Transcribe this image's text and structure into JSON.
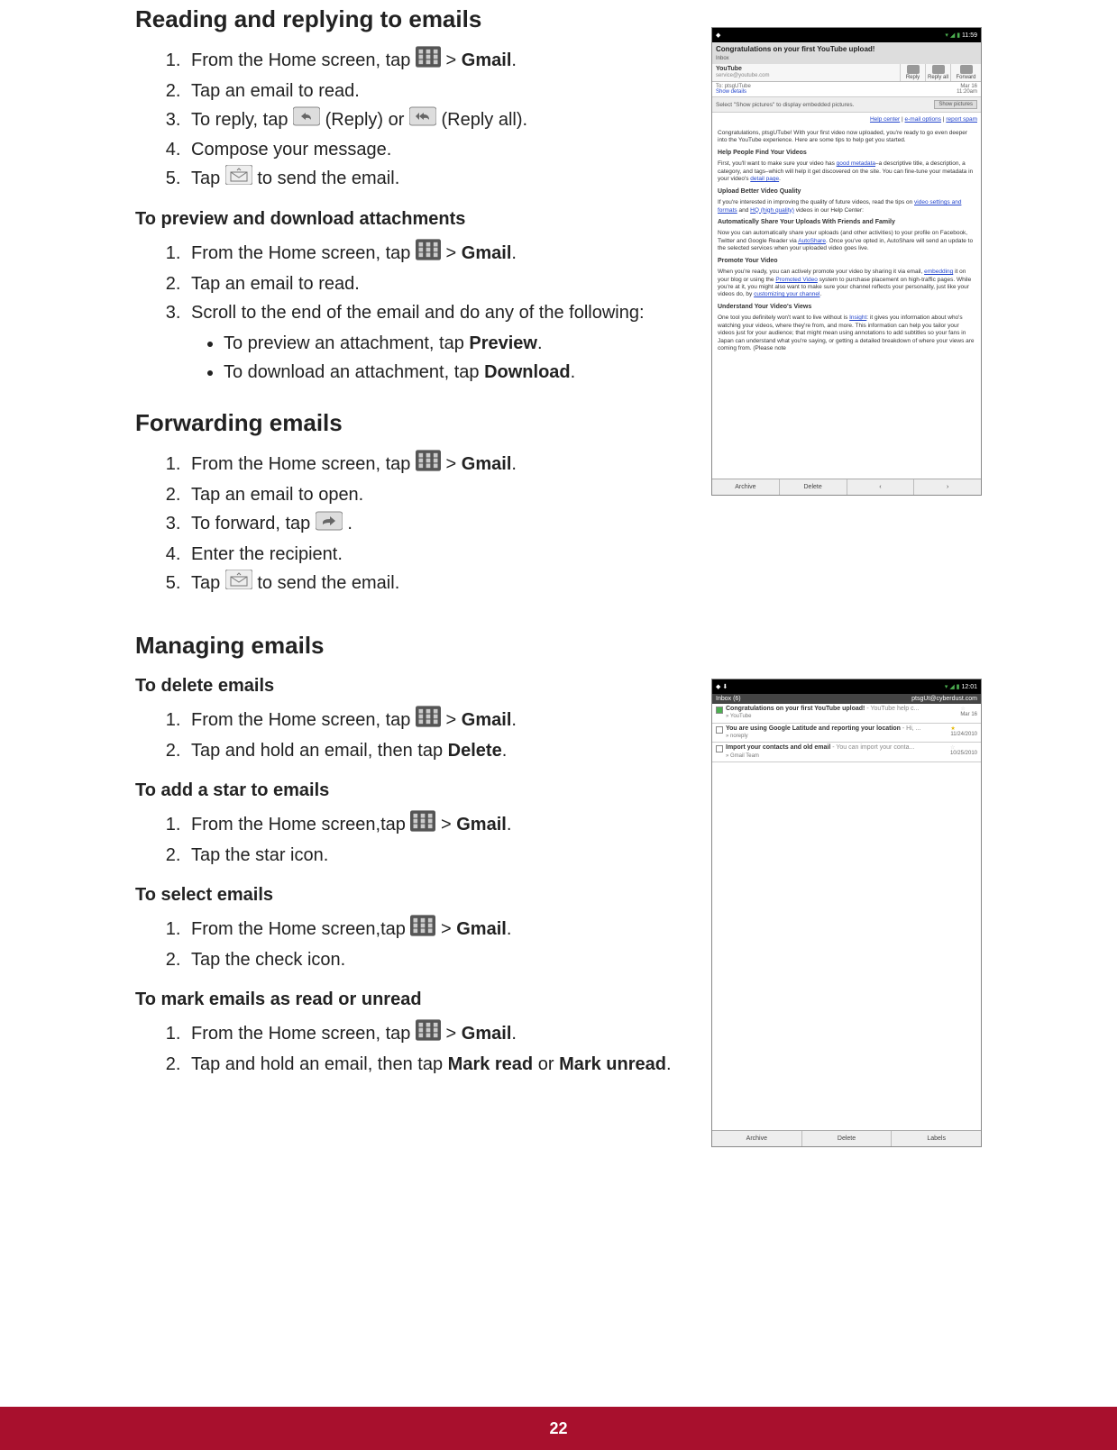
{
  "page_number": "22",
  "s1": {
    "title": "Reading and replying to emails",
    "step1_a": "From the Home screen, tap ",
    "step1_sep": " > ",
    "gmail": "Gmail",
    "step1_end": ".",
    "step2": "Tap an email to read.",
    "step3_a": "To reply, tap ",
    "step3_b": " (Reply) or ",
    "step3_c": " (Reply all).",
    "step4": "Compose your message.",
    "step5_a": "Tap ",
    "step5_b": " to send the email."
  },
  "s2": {
    "title": "To preview and download attachments",
    "step1_a": "From the Home screen, tap ",
    "step2": "Tap an email to read.",
    "step3": "Scroll to the end of the email and do any of the following:",
    "b1_a": "To preview an attachment, tap ",
    "b1_b": "Preview",
    "b1_c": ".",
    "b2_a": "To download an attachment, tap ",
    "b2_b": "Download",
    "b2_c": "."
  },
  "s3": {
    "title": "Forwarding emails",
    "step1_a": "From the Home screen, tap ",
    "step2": "Tap an email to open.",
    "step3_a": "To forward, tap ",
    "step3_b": " .",
    "step4": "Enter the recipient.",
    "step5_a": "Tap ",
    "step5_b": " to send the email."
  },
  "s4": {
    "title": "Managing emails"
  },
  "s5": {
    "title": "To delete emails",
    "step1_a": "From the Home screen, tap ",
    "step2_a": "Tap and hold an email, then tap ",
    "step2_b": "Delete",
    "step2_c": "."
  },
  "s6": {
    "title": "To add a star to emails",
    "step1_a": "From the Home screen,tap ",
    "step2": "Tap the star icon."
  },
  "s7": {
    "title": "To select emails",
    "step1_a": "From the Home screen,tap ",
    "step2": "Tap the check icon."
  },
  "s8": {
    "title": "To mark emails as read or unread",
    "step1_a": "From the Home screen, tap ",
    "step2_a": "Tap and hold an email, then tap ",
    "step2_b": "Mark read",
    "step2_c": " or ",
    "step2_d": "Mark unread",
    "step2_e": "."
  },
  "shot1": {
    "time": "11:59",
    "subject": "Congratulations on your first YouTube upload!",
    "inbox_label": "Inbox",
    "sender_name": "YouTube",
    "sender_email": "service@youtube.com",
    "reply": "Reply",
    "reply_all": "Reply all",
    "forward": "Forward",
    "to": "To: ptsgUTube",
    "date": "Mar 16",
    "time2": "11:20am",
    "show_details": "Show details",
    "show_pics_msg": "Select \"Show pictures\" to display embedded pictures.",
    "show_pics_btn": "Show pictures",
    "help_center": "Help center",
    "email_options": "e-mail options",
    "report_spam": "report spam",
    "body_open": "Congratulations, ptsgUTube! With your first video now uploaded, you're ready to go even deeper into the YouTube experience. Here are some tips to help get you started.",
    "h1": "Help People Find Your Videos",
    "p1a": "First, you'll want to make sure your video has ",
    "p1_link1": "good metadata",
    "p1b": "–a descriptive title, a description, a category, and tags–which will help it get discovered on the site. You can fine-tune your metadata in your video's ",
    "p1_link2": "detail page",
    "p1c": ".",
    "h2": "Upload Better Video Quality",
    "p2a": "If you're interested in improving the quality of future videos, read the tips on ",
    "p2_link1": "video settings and formats",
    "p2b": " and ",
    "p2_link2": "HQ (high quality)",
    "p2c": " videos in our Help Center:",
    "h3": "Automatically Share Your Uploads With Friends and Family",
    "p3a": "Now you can automatically share your uploads (and other activities) to your profile on Facebook, Twitter and Google Reader via ",
    "p3_link1": "AutoShare",
    "p3b": ". Once you've opted in, AutoShare will send an update to the selected services when your uploaded video goes live.",
    "h4": "Promote Your Video",
    "p4a": "When you're ready, you can actively promote your video by sharing it via email, ",
    "p4_link1": "embedding",
    "p4b": " it on your blog or using the ",
    "p4_link2": "Promoted Video",
    "p4c": " system to purchase placement on high-traffic pages. While you're at it, you might also want to make sure your channel reflects your personality, just like your videos do, by ",
    "p4_link3": "customizing your channel",
    "p4d": ".",
    "h5": "Understand Your Video's Views",
    "p5a": "One tool you definitely won't want to live without is ",
    "p5_link1": "Insight",
    "p5b": ": it gives you information about who's watching your videos, where they're from, and more. This information can help you tailor your videos just for your audience; that might mean using annotations to add subtitles so your fans in Japan can understand what you're saying, or getting a detailed breakdown of where your views are coming from. (Please note",
    "archive": "Archive",
    "delete": "Delete",
    "prev": "‹",
    "next": "›"
  },
  "shot2": {
    "time": "12:01",
    "inbox": "Inbox (6)",
    "account": "ptsgUt@cyberdust.com",
    "m1_subject": "Congratulations on your first YouTube upload!",
    "m1_preview": " - YouTube help c...",
    "m1_sender": "» YouTube",
    "m1_date": "Mar 16",
    "m2_subject": "You are using Google Latitude and reporting your location",
    "m2_preview": " - Hi, ...",
    "m2_sender": "» noreply",
    "m2_date": "11/24/2010",
    "m3_subject": "Import your contacts and old email",
    "m3_preview": " - You can import your conta...",
    "m3_sender": "» Gmail Team",
    "m3_date": "10/25/2010",
    "archive": "Archive",
    "delete": "Delete",
    "labels": "Labels"
  }
}
